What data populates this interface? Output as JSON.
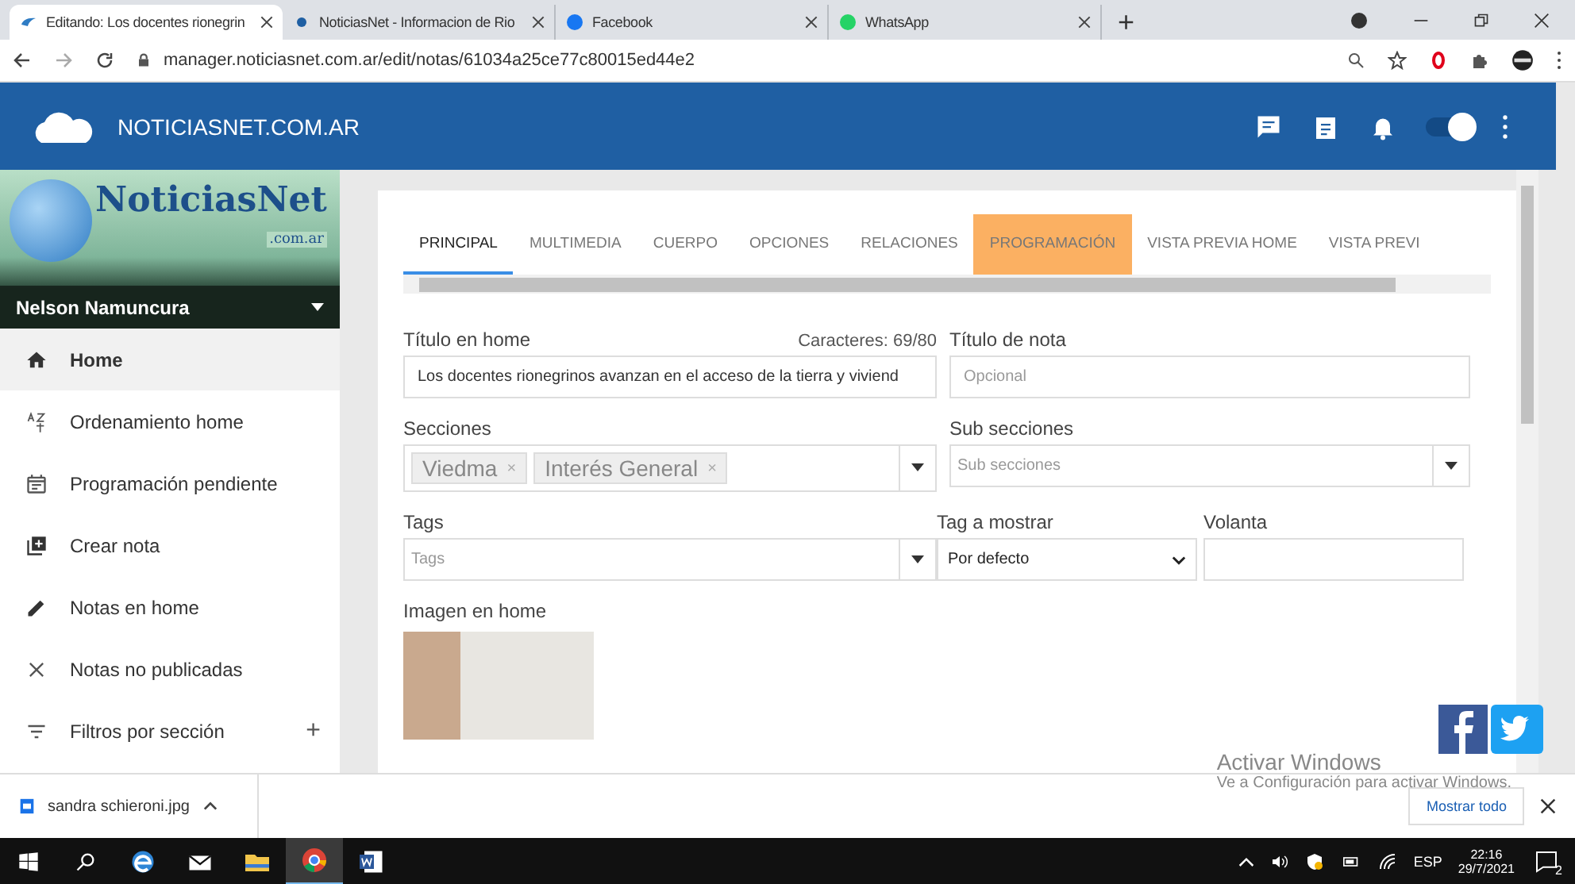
{
  "browser": {
    "tabs": [
      {
        "title": "Editando: Los docentes rionegrin",
        "selected": true
      },
      {
        "title": "NoticiasNet - Informacion de Rio",
        "selected": false
      },
      {
        "title": "Facebook",
        "selected": false
      },
      {
        "title": "WhatsApp",
        "selected": false
      }
    ],
    "new_tab": "+",
    "url": "manager.noticiasnet.com.ar/edit/notas/61034a25ce77c80015ed44e2"
  },
  "header": {
    "brand": "NOTICIASNET.COM.AR",
    "toggle": {
      "on": true
    }
  },
  "sidebar": {
    "logo": {
      "name": "NoticiasNet",
      "suffix": ".com.ar"
    },
    "user": "Nelson Namuncura",
    "items": [
      {
        "label": "Home",
        "selected": true
      },
      {
        "label": "Ordenamiento home",
        "selected": false
      },
      {
        "label": "Programación pendiente",
        "selected": false
      },
      {
        "label": "Crear nota",
        "selected": false
      },
      {
        "label": "Notas en home",
        "selected": false
      },
      {
        "label": "Notas no publicadas",
        "selected": false
      },
      {
        "label": "Filtros por sección",
        "selected": false,
        "expand": "+"
      }
    ]
  },
  "editor": {
    "tabs": [
      {
        "label": "PRINCIPAL",
        "selected": true,
        "highlighted": false
      },
      {
        "label": "MULTIMEDIA",
        "selected": false,
        "highlighted": false
      },
      {
        "label": "CUERPO",
        "selected": false,
        "highlighted": false
      },
      {
        "label": "OPCIONES",
        "selected": false,
        "highlighted": false
      },
      {
        "label": "RELACIONES",
        "selected": false,
        "highlighted": false
      },
      {
        "label": "PROGRAMACIÓN",
        "selected": false,
        "highlighted": true
      },
      {
        "label": "VISTA PREVIA HOME",
        "selected": false,
        "highlighted": false
      },
      {
        "label": "VISTA PREVI",
        "selected": false,
        "highlighted": false
      }
    ],
    "title_home": {
      "label": "Título en home",
      "counter": "Caracteres: 69/80",
      "value": "Los docentes rionegrinos avanzan en el acceso de la tierra y viviend"
    },
    "title_note": {
      "label": "Título de nota",
      "placeholder": "Opcional"
    },
    "sections": {
      "label": "Secciones",
      "chips": [
        {
          "label": "Viedma",
          "remove": "×"
        },
        {
          "label": "Interés General",
          "remove": "×"
        }
      ]
    },
    "subsections": {
      "label": "Sub secciones",
      "placeholder": "Sub secciones"
    },
    "tags": {
      "label": "Tags",
      "placeholder": "Tags"
    },
    "tag_display": {
      "label": "Tag a mostrar",
      "value": "Por defecto"
    },
    "volanta": {
      "label": "Volanta"
    },
    "image": {
      "label": "Imagen en home"
    }
  },
  "windows_notice": {
    "title": "Activar Windows",
    "text": "Ve a Configuración para activar Windows."
  },
  "downloads": {
    "file": "sandra schieroni.jpg",
    "show_all": "Mostrar todo"
  },
  "taskbar": {
    "apps": [
      {
        "kind": "edge",
        "selected": false
      },
      {
        "kind": "mail",
        "selected": false
      },
      {
        "kind": "folder",
        "selected": false
      },
      {
        "kind": "chrome",
        "selected": true
      },
      {
        "kind": "word",
        "selected": false
      }
    ],
    "language": "ESP",
    "time": "22:16",
    "date": "29/7/2021",
    "notifications": "2"
  }
}
